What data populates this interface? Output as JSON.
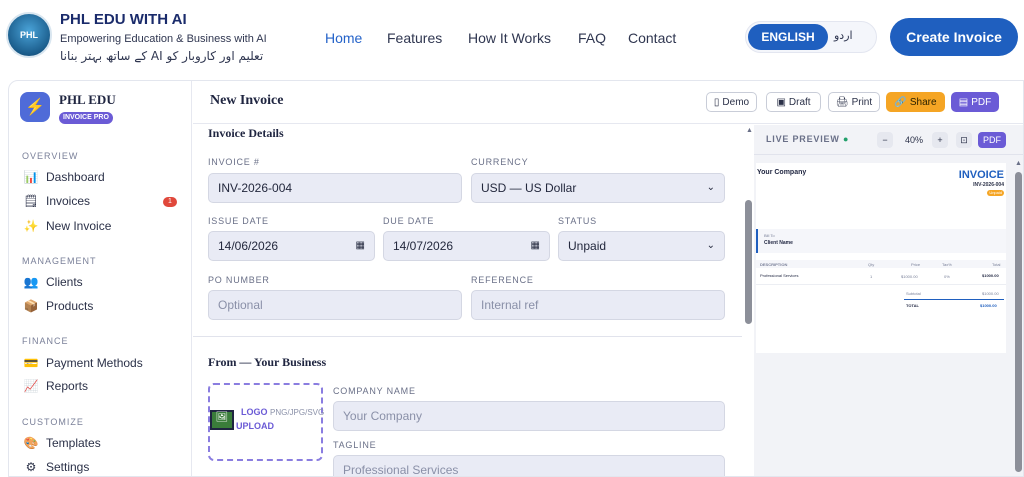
{
  "nav": {
    "logo_text": "PHL",
    "brand": "PHL EDU WITH AI",
    "tagline": "Empowering Education & Business with AI",
    "tagline_urdu": "کے ساتھ بہتر بنانا AI تعلیم اور کاروبار کو",
    "links": [
      "Home",
      "Features",
      "How It Works",
      "FAQ",
      "Contact"
    ],
    "lang_en": "ENGLISH",
    "lang_ur": "اردو",
    "cta": "Create Invoice"
  },
  "sidebar": {
    "title": "PHL EDU",
    "badge": "INVOICE PRO",
    "sections": [
      "OVERVIEW",
      "MANAGEMENT",
      "FINANCE",
      "CUSTOMIZE"
    ],
    "items": [
      "Dashboard",
      "Invoices",
      "New Invoice",
      "Clients",
      "Products",
      "Payment Methods",
      "Reports",
      "Templates",
      "Settings"
    ],
    "invoice_count": "1"
  },
  "header": {
    "title": "New Invoice",
    "buttons": [
      "Demo",
      "Draft",
      "Print",
      "Share",
      "PDF"
    ]
  },
  "form": {
    "details_title": "Invoice Details",
    "invoice_no_label": "INVOICE #",
    "invoice_no": "INV-2026-004",
    "currency_label": "CURRENCY",
    "currency": "USD — US Dollar",
    "issue_label": "ISSUE DATE",
    "issue_date": "14/06/2026",
    "due_label": "DUE DATE",
    "due_date": "14/07/2026",
    "status_label": "STATUS",
    "status": "Unpaid",
    "po_label": "PO NUMBER",
    "po_placeholder": "Optional",
    "ref_label": "REFERENCE",
    "ref_placeholder": "Internal ref",
    "from_title": "From — Your Business",
    "logo_label": "LOGO",
    "logo_formats": "PNG/JPG/SVG",
    "upload_label": "UPLOAD",
    "company_label": "COMPANY NAME",
    "company_placeholder": "Your Company",
    "tagline_label": "TAGLINE",
    "tagline_placeholder": "Professional Services"
  },
  "preview": {
    "title": "LIVE PREVIEW",
    "zoom": "40%",
    "pdf": "PDF",
    "company": "Your Company",
    "doc_title": "INVOICE",
    "number": "INV-2026-004",
    "status": "Unpaid",
    "bill_to": "Bill To",
    "client": "Client Name",
    "cols": [
      "DESCRIPTION",
      "Qty",
      "Price",
      "Tax%",
      "Total"
    ],
    "row": [
      "Professional Services",
      "1",
      "$1000.00",
      "0%",
      "$1000.00"
    ],
    "subtotal_label": "Subtotal",
    "subtotal": "$1000.00",
    "total_label": "TOTAL",
    "total": "$1000.00"
  }
}
